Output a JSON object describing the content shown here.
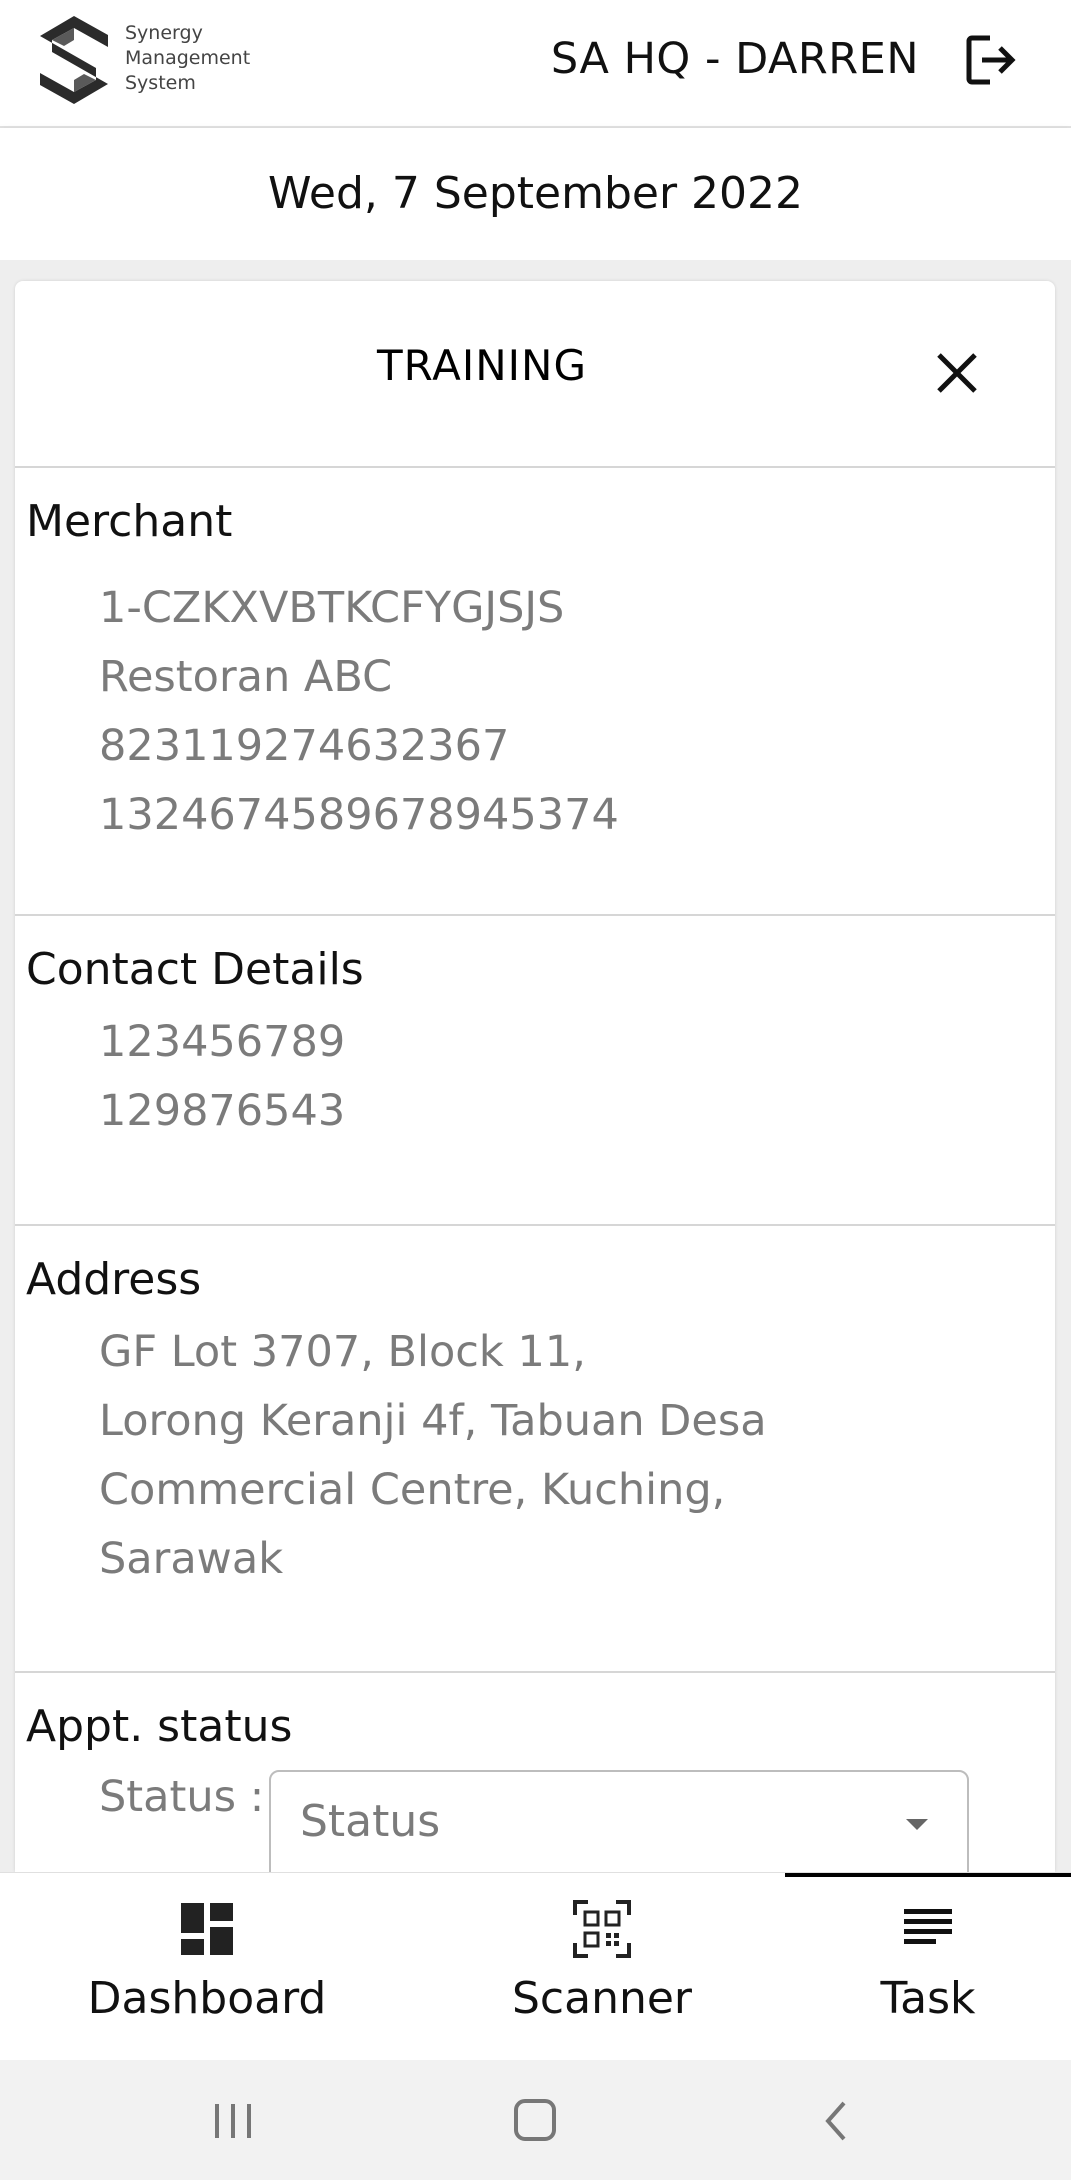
{
  "header": {
    "logo_lines": [
      "Synergy",
      "Management",
      "System"
    ],
    "user": "SA HQ - DARREN",
    "logout_icon": "logout-icon"
  },
  "date": "Wed, 7 September 2022",
  "card": {
    "title": "TRAINING",
    "close_icon": "close-icon",
    "merchant": {
      "title": "Merchant",
      "lines": [
        "1-CZKXVBTKCFYGJSJS",
        "Restoran ABC",
        "823119274632367",
        "1324674589678945374"
      ]
    },
    "contact": {
      "title": "Contact Details",
      "lines": [
        "123456789",
        "129876543"
      ]
    },
    "address": {
      "title": "Address",
      "lines": [
        "GF Lot 3707, Block 11,",
        "Lorong Keranji 4f, Tabuan Desa",
        "Commercial Centre, Kuching,",
        "Sarawak"
      ]
    },
    "appt": {
      "title": "Appt. status",
      "status_label": "Status :",
      "status_value": "Status"
    }
  },
  "bottom_nav": {
    "items": [
      {
        "label": "Dashboard",
        "icon": "dashboard-icon",
        "active": false
      },
      {
        "label": "Scanner",
        "icon": "qr-scanner-icon",
        "active": false
      },
      {
        "label": "Task",
        "icon": "task-list-icon",
        "active": true
      }
    ]
  },
  "system_nav": [
    "recent-apps-icon",
    "home-icon",
    "back-icon"
  ],
  "colors": {
    "text_primary": "#111111",
    "text_secondary": "#7b7b7b",
    "divider": "#d6d6d6",
    "background": "#eeeeee"
  }
}
